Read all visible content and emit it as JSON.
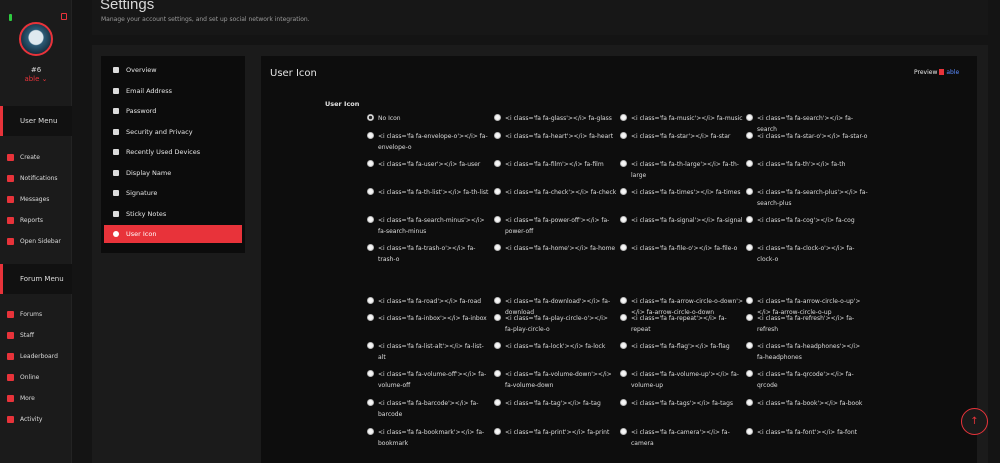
{
  "sidebar": {
    "user_number": "#6",
    "user_name": "able ⌄",
    "user_menu_label": "User Menu",
    "forum_menu_label": "Forum Menu",
    "user_items": [
      {
        "label": "Create",
        "icon": "plus-circle-icon"
      },
      {
        "label": "Notifications",
        "icon": "bell-icon"
      },
      {
        "label": "Messages",
        "icon": "envelope-icon"
      },
      {
        "label": "Reports",
        "icon": "flag-icon"
      },
      {
        "label": "Open Sidebar",
        "icon": "toggle-icon"
      }
    ],
    "forum_items": [
      {
        "label": "Forums",
        "icon": "forum-icon"
      },
      {
        "label": "Staff",
        "icon": "users-icon"
      },
      {
        "label": "Leaderboard",
        "icon": "trophy-icon"
      },
      {
        "label": "Online",
        "icon": "power-icon"
      },
      {
        "label": "More",
        "icon": "more-icon"
      },
      {
        "label": "Activity",
        "icon": "activity-icon"
      }
    ],
    "accent": "#e8333a"
  },
  "header": {
    "title": "Settings",
    "subtitle": "Manage your account settings, and set up social network integration."
  },
  "subnav": [
    {
      "label": "Overview",
      "icon": "dashboard-icon"
    },
    {
      "label": "Email Address",
      "icon": "envelope-icon"
    },
    {
      "label": "Password",
      "icon": "key-icon"
    },
    {
      "label": "Security and Privacy",
      "icon": "lock-icon"
    },
    {
      "label": "Recently Used Devices",
      "icon": "laptop-icon"
    },
    {
      "label": "Display Name",
      "icon": "id-card-icon"
    },
    {
      "label": "Signature",
      "icon": "pencil-icon"
    },
    {
      "label": "Sticky Notes",
      "icon": "sticky-note-icon"
    },
    {
      "label": "User Icon",
      "icon": "user-circle-icon"
    }
  ],
  "content": {
    "title": "User Icon",
    "preview_label": "Preview",
    "preview_value": "able",
    "field_label": "User Icon"
  },
  "options": [
    [
      "No Icon",
      "<i class='fa fa-glass'></i> fa-glass",
      "<i class='fa fa-music'></i> fa-music",
      "<i class='fa fa-search'></i> fa-search"
    ],
    [
      "<i class='fa fa-envelope-o'></i> fa-envelope-o",
      "<i class='fa fa-heart'></i> fa-heart",
      "<i class='fa fa-star'></i> fa-star",
      "<i class='fa fa-star-o'></i> fa-star-o"
    ],
    [
      "<i class='fa fa-user'></i> fa-user",
      "<i class='fa fa-film'></i> fa-film",
      "<i class='fa fa-th-large'></i> fa-th-large",
      "<i class='fa fa-th'></i> fa-th"
    ],
    [
      "<i class='fa fa-th-list'></i> fa-th-list",
      "<i class='fa fa-check'></i> fa-check",
      "<i class='fa fa-times'></i> fa-times",
      "<i class='fa fa-search-plus'></i> fa-search-plus"
    ],
    [
      "<i class='fa fa-search-minus'></i> fa-search-minus",
      "<i class='fa fa-power-off'></i> fa-power-off",
      "<i class='fa fa-signal'></i> fa-signal",
      "<i class='fa fa-cog'></i> fa-cog"
    ],
    [
      "<i class='fa fa-trash-o'></i> fa-trash-o",
      "<i class='fa fa-home'></i> fa-home",
      "<i class='fa fa-file-o'></i> fa-file-o",
      "<i class='fa fa-clock-o'></i> fa-clock-o"
    ],
    [
      "<i class='fa fa-road'></i> fa-road",
      "<i class='fa fa-download'></i> fa-download",
      "<i class='fa fa-arrow-circle-o-down'></i> fa-arrow-circle-o-down",
      "<i class='fa fa-arrow-circle-o-up'></i> fa-arrow-circle-o-up"
    ],
    [
      "<i class='fa fa-inbox'></i> fa-inbox",
      "<i class='fa fa-play-circle-o'></i> fa-play-circle-o",
      "<i class='fa fa-repeat'></i> fa-repeat",
      "<i class='fa fa-refresh'></i> fa-refresh"
    ],
    [
      "<i class='fa fa-list-alt'></i> fa-list-alt",
      "<i class='fa fa-lock'></i> fa-lock",
      "<i class='fa fa-flag'></i> fa-flag",
      "<i class='fa fa-headphones'></i> fa-headphones"
    ],
    [
      "<i class='fa fa-volume-off'></i> fa-volume-off",
      "<i class='fa fa-volume-down'></i> fa-volume-down",
      "<i class='fa fa-volume-up'></i> fa-volume-up",
      "<i class='fa fa-qrcode'></i> fa-qrcode"
    ],
    [
      "<i class='fa fa-barcode'></i> fa-barcode",
      "<i class='fa fa-tag'></i> fa-tag",
      "<i class='fa fa-tags'></i> fa-tags",
      "<i class='fa fa-book'></i> fa-book"
    ],
    [
      "<i class='fa fa-bookmark'></i> fa-bookmark",
      "<i class='fa fa-print'></i> fa-print",
      "<i class='fa fa-camera'></i> fa-camera",
      "<i class='fa fa-font'></i> fa-font"
    ]
  ],
  "selected_option": "No Icon",
  "scroll_top_icon": "arrow-up-icon"
}
